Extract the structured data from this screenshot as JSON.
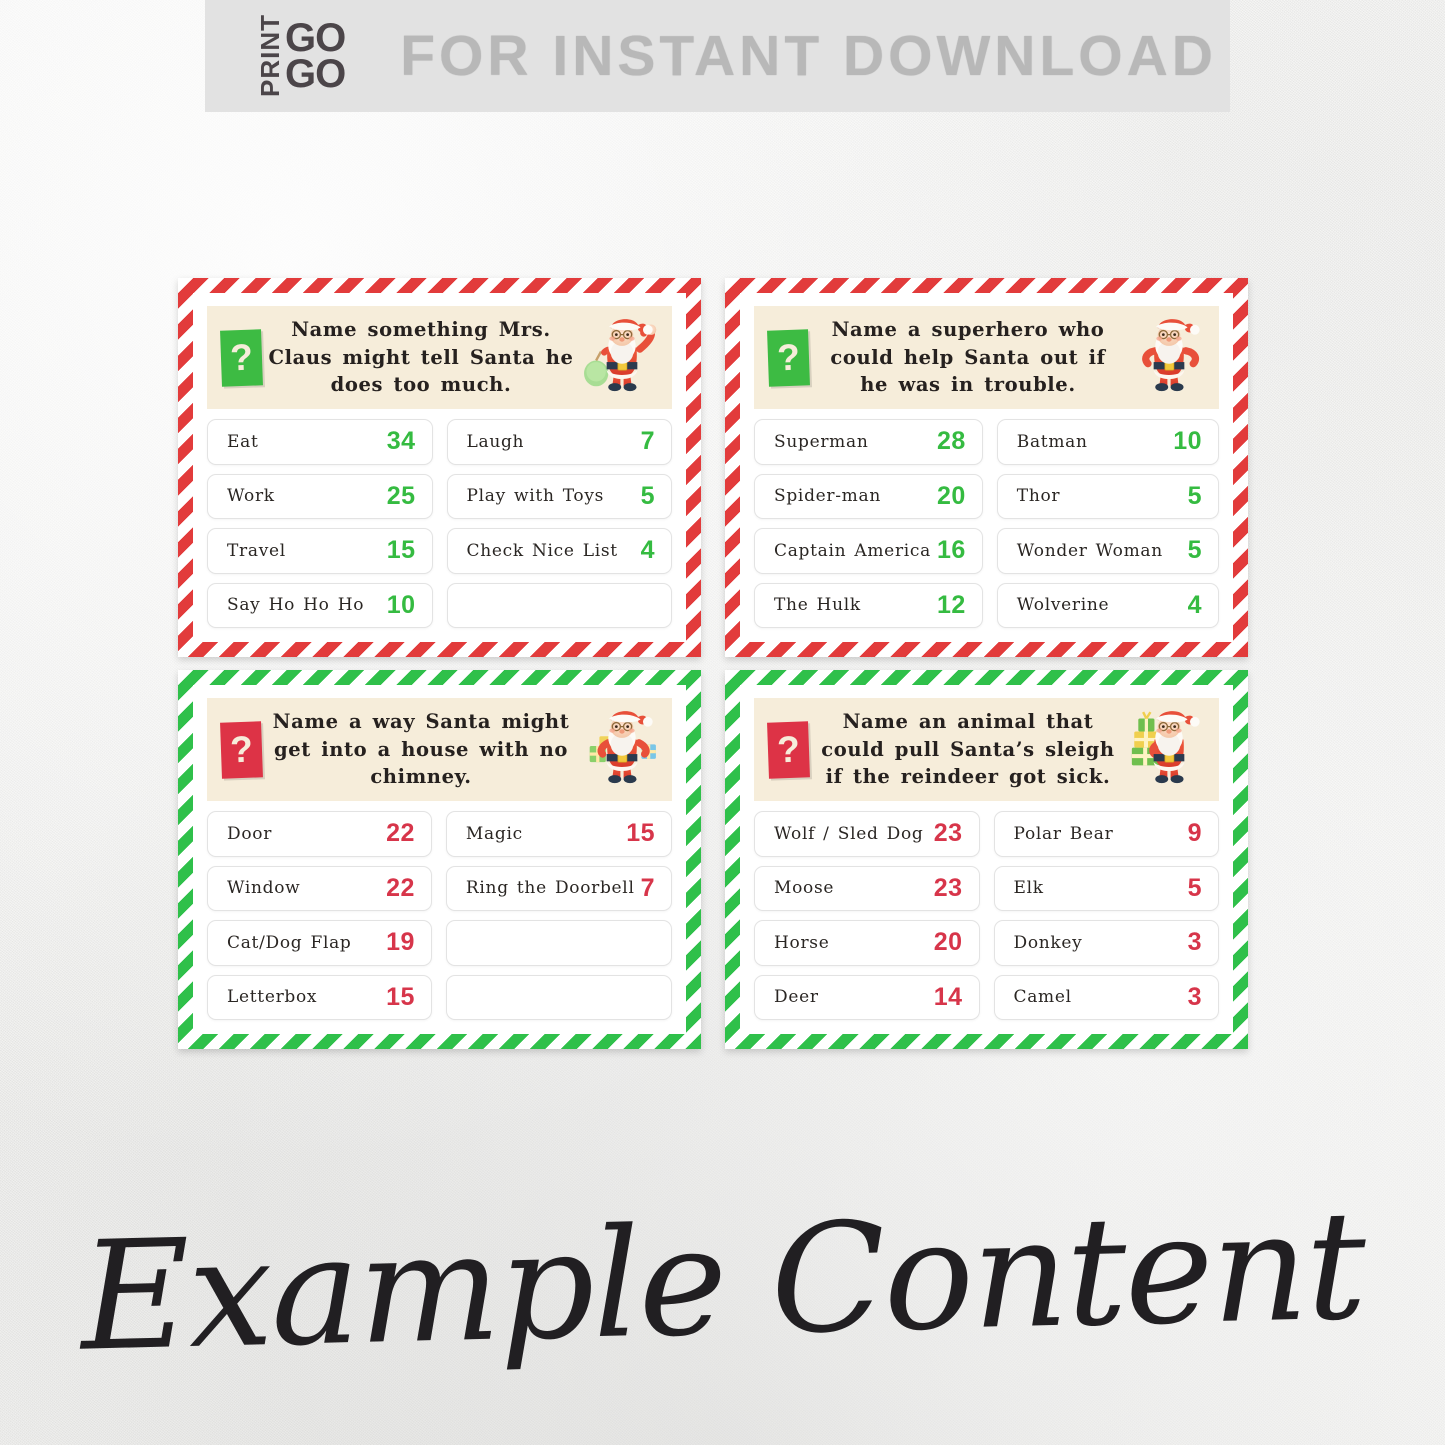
{
  "banner": {
    "logo_print": "PRINT",
    "logo_go_top": "GO",
    "logo_go_bottom": "GO",
    "title": "FOR INSTANT DOWNLOAD"
  },
  "footer": {
    "caption": "Example Content"
  },
  "colors": {
    "red": "#dd3346",
    "green": "#3dbb43",
    "score_green": "#35bb41",
    "score_red": "#d7354a",
    "header_cream": "#f6edda",
    "background": "#ededeb",
    "banner": "#e2e2e2",
    "banner_text": "#b8b8b8",
    "logo": "#4b4549"
  },
  "cards": [
    {
      "frame": "red",
      "badge_color": "green",
      "badge_symbol": "?",
      "santa": "santa-waving-with-sack",
      "question": "Name something Mrs. Claus might tell Santa he does too much.",
      "score_color": "green",
      "left_column": [
        {
          "label": "Eat",
          "score": "34"
        },
        {
          "label": "Work",
          "score": "25"
        },
        {
          "label": "Travel",
          "score": "15"
        },
        {
          "label": "Say Ho Ho Ho",
          "score": "10"
        }
      ],
      "right_column": [
        {
          "label": "Laugh",
          "score": "7"
        },
        {
          "label": "Play with Toys",
          "score": "5"
        },
        {
          "label": "Check Nice List",
          "score": "4"
        },
        {
          "label": "",
          "score": ""
        }
      ]
    },
    {
      "frame": "red",
      "badge_color": "green",
      "badge_symbol": "?",
      "santa": "santa-hands-on-hips",
      "question": "Name a superhero who could help Santa out if he was in trouble.",
      "score_color": "green",
      "left_column": [
        {
          "label": "Superman",
          "score": "28"
        },
        {
          "label": "Spider-man",
          "score": "20"
        },
        {
          "label": "Captain America",
          "score": "16"
        },
        {
          "label": "The Hulk",
          "score": "12"
        }
      ],
      "right_column": [
        {
          "label": "Batman",
          "score": "10"
        },
        {
          "label": "Thor",
          "score": "5"
        },
        {
          "label": "Wonder Woman",
          "score": "5"
        },
        {
          "label": "Wolverine",
          "score": "4"
        }
      ]
    },
    {
      "frame": "green",
      "badge_color": "red",
      "badge_symbol": "?",
      "santa": "santa-holding-gifts",
      "question": "Name a way Santa might get into a house with no chimney.",
      "score_color": "red",
      "left_column": [
        {
          "label": "Door",
          "score": "22"
        },
        {
          "label": "Window",
          "score": "22"
        },
        {
          "label": "Cat/Dog Flap",
          "score": "19"
        },
        {
          "label": "Letterbox",
          "score": "15"
        }
      ],
      "right_column": [
        {
          "label": "Magic",
          "score": "15"
        },
        {
          "label": "Ring the Doorbell",
          "score": "7"
        },
        {
          "label": "",
          "score": ""
        },
        {
          "label": "",
          "score": ""
        }
      ]
    },
    {
      "frame": "green",
      "badge_color": "red",
      "badge_symbol": "?",
      "santa": "santa-carrying-gift-stack",
      "question": "Name an animal that could pull Santa’s sleigh if the reindeer got sick.",
      "score_color": "red",
      "left_column": [
        {
          "label": "Wolf / Sled Dog",
          "score": "23"
        },
        {
          "label": "Moose",
          "score": "23"
        },
        {
          "label": "Horse",
          "score": "20"
        },
        {
          "label": "Deer",
          "score": "14"
        }
      ],
      "right_column": [
        {
          "label": "Polar Bear",
          "score": "9"
        },
        {
          "label": "Elk",
          "score": "5"
        },
        {
          "label": "Donkey",
          "score": "3"
        },
        {
          "label": "Camel",
          "score": "3"
        }
      ]
    }
  ]
}
